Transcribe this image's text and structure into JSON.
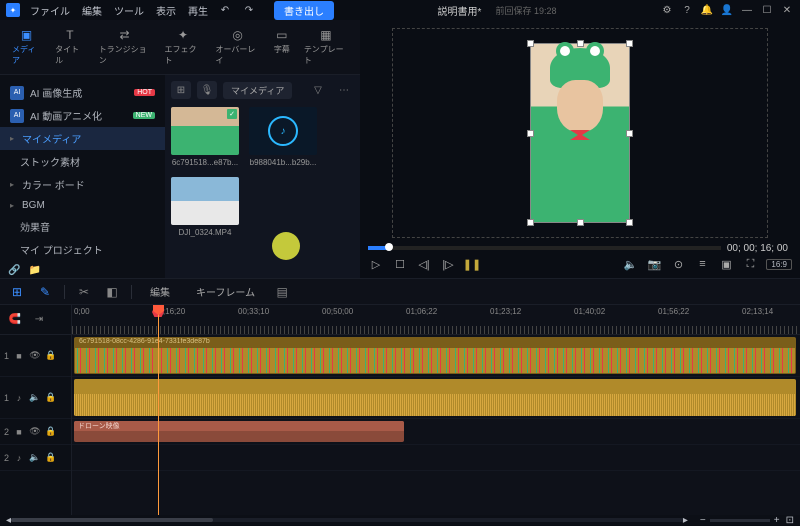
{
  "menu": {
    "file": "ファイル",
    "edit": "編集",
    "tool": "ツール",
    "view": "表示",
    "play": "再生"
  },
  "export_label": "書き出し",
  "doc": {
    "title": "説明書用*",
    "saved": "前回保存 19:28"
  },
  "tabs": {
    "media": "メディア",
    "title": "タイトル",
    "transition": "トランジション",
    "effect": "エフェクト",
    "overlay": "オーバーレイ",
    "subtitle": "字幕",
    "template": "テンプレート"
  },
  "sidebar": {
    "ai_image": "AI 画像生成",
    "ai_anim": "AI 動画アニメ化",
    "hot": "HOT",
    "new": "NEW",
    "my_media": "マイメディア",
    "stock": "ストック素材",
    "color_board": "カラー ボード",
    "bgm": "BGM",
    "sfx": "効果音",
    "my_project": "マイ プロジェクト"
  },
  "media_toolbar": {
    "dropdown": "マイメディア"
  },
  "thumbs": {
    "t1": "6c791518...e87b...",
    "t2": "b988041b...b29b...",
    "t3": "DJI_0324.MP4"
  },
  "preview": {
    "timecode": "00; 00; 16; 00",
    "aspect": "16:9"
  },
  "timeline": {
    "edit": "編集",
    "keyframe": "キーフレーム",
    "ruler": [
      "0;00",
      "00;16;20",
      "00;33;10",
      "00;50;00",
      "01;06;22",
      "01;23;12",
      "01;40;02",
      "01;56;22",
      "02;13;14"
    ],
    "clip1_header": "6c791518-08cc-4286-91e4-7331fe3de87b",
    "clip_drone": "ドローン映像",
    "tracks": {
      "t1": "1",
      "t2": "1",
      "t3": "2",
      "t4": "2"
    }
  }
}
